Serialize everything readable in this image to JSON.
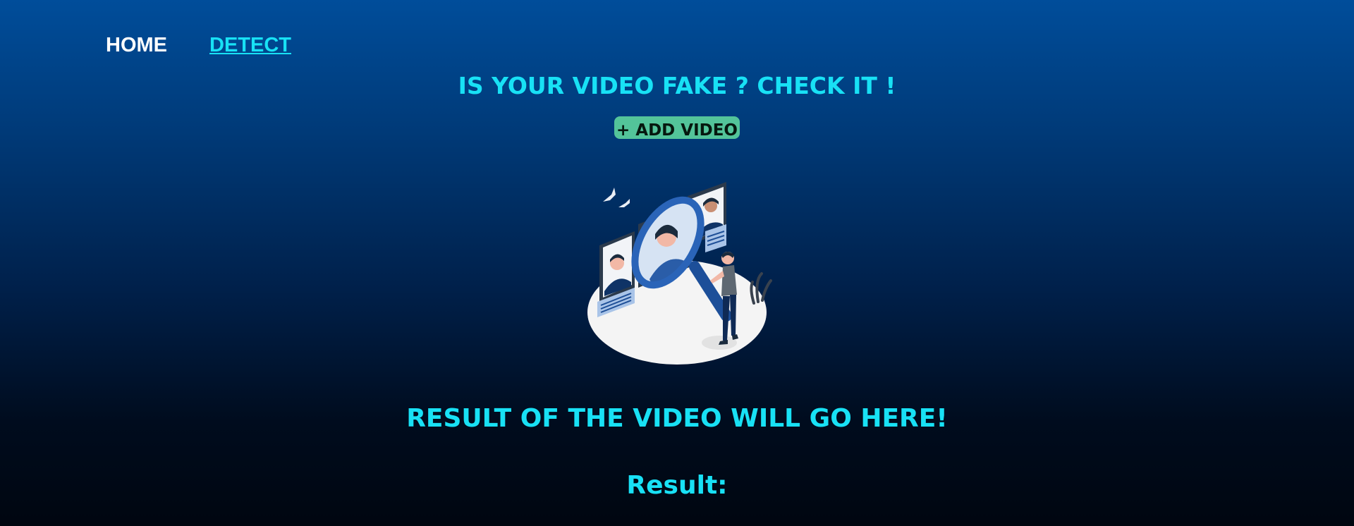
{
  "nav": {
    "home_label": "HOME",
    "detect_label": "DETECT"
  },
  "main": {
    "headline": "IS YOUR VIDEO FAKE ? CHECK IT !",
    "add_video_label": "+ ADD VIDEO",
    "result_heading": "RESULT OF THE VIDEO WILL GO HERE!",
    "result_label": "Result:"
  },
  "illustration": {
    "name": "face-inspection-illustration"
  },
  "colors": {
    "accent": "#18e1f5",
    "button": "#53c49a",
    "nav_text": "#ffffff",
    "bg_top": "#004d9a",
    "bg_bottom": "#000610"
  }
}
